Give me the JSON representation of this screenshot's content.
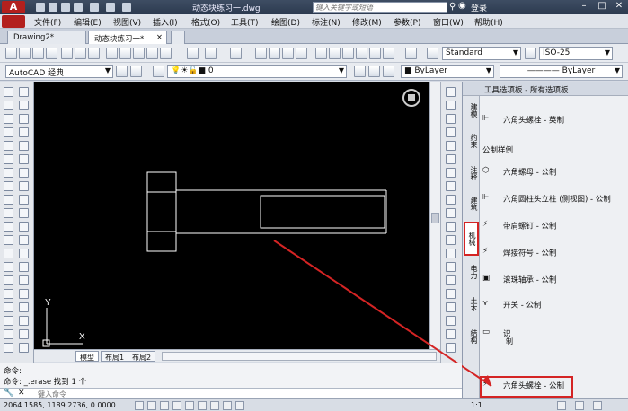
{
  "titlebar": {
    "document_title": "动态块练习一.dwg",
    "search_placeholder": "键入关键字或短语",
    "login_label": "登录"
  },
  "menubar": {
    "items": [
      "文件(F)",
      "编辑(E)",
      "视图(V)",
      "插入(I)",
      "格式(O)",
      "工具(T)",
      "绘图(D)",
      "标注(N)",
      "修改(M)",
      "参数(P)",
      "窗口(W)",
      "帮助(H)"
    ]
  },
  "tabs": {
    "items": [
      {
        "label": "Drawing2*"
      },
      {
        "label": "动态块练习一*"
      }
    ]
  },
  "toolbar": {
    "text_style": "Standard",
    "dim_style": "ISO-25",
    "workspace": "AutoCAD 经典",
    "layer": "0",
    "color": "ByLayer",
    "linetype": "ByLayer"
  },
  "layout_tabs": [
    "模型",
    "布局1",
    "布局2"
  ],
  "palette": {
    "title": "工具选项板 - 所有选项板",
    "tabs": [
      "建模",
      "约束",
      "注释",
      "建筑",
      "机械",
      "电力",
      "土木",
      "结构"
    ],
    "active_tab": "机械",
    "items": [
      {
        "label": "六角头螺栓 - 英制",
        "icon": "hex-bolt-icon"
      },
      {
        "label": "六角螺母 - 公制",
        "icon": "hex-nut-icon"
      },
      {
        "label": "六角圆柱头立柱 (侧视图) - 公制",
        "icon": "socket-head-icon"
      },
      {
        "label": "带肩螺钉 - 公制",
        "icon": "shoulder-screw-icon"
      },
      {
        "label": "焊接符号 - 公制",
        "icon": "weld-symbol-icon"
      },
      {
        "label": "滚珠轴承 - 公制",
        "icon": "ball-bearing-icon"
      },
      {
        "label": "开关 - 公制",
        "icon": "switch-icon"
      },
      {
        "label": "六角头螺栓 - 公制",
        "icon": "hex-bolt-icon"
      }
    ],
    "section_label": "公制样例",
    "partial_label_1": "识",
    "partial_label_2": "制"
  },
  "command": {
    "line1": "命令:",
    "line2": "命令: _.erase 找到 1 个",
    "input_placeholder": "键入命令"
  },
  "statusbar": {
    "coordinates": "2064.1585, 1189.2736, 0.0000",
    "scale": "1:1"
  },
  "axis": {
    "x": "X",
    "y": "Y"
  }
}
